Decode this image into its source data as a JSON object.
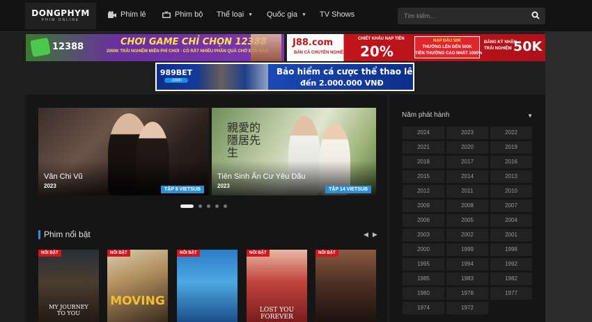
{
  "logo": {
    "main": "DONGPHYM",
    "sub": "PHIM ONLINE"
  },
  "nav": [
    {
      "label": "Phim lẻ",
      "icon": "film-icon"
    },
    {
      "label": "Phim bộ",
      "icon": "tv-icon"
    },
    {
      "label": "Thể loại",
      "icon": "chevron-down-icon"
    },
    {
      "label": "Quốc gia",
      "icon": "chevron-down-icon"
    },
    {
      "label": "TV Shows"
    }
  ],
  "search": {
    "placeholder": "Tìm kiếm..."
  },
  "ads": {
    "a": {
      "brand": "12388",
      "title": "CHƠI GAME CHỈ CHỌN 12388",
      "sub": "2000K TRẢI NGHIỆM MIỄN PHÍ CHƠI · CÓ RẤT NHIỀU PHẦN QUÀ CHỜ ĐÓN BẠN"
    },
    "b": {
      "brand": "J88.com",
      "brand_sub": "BẢN CÁ CHUYÊN NGHIỆP",
      "t1": "CHIẾT KHẤU NẠP TIỀN",
      "pct": "20%",
      "box1": "NẠP ĐẦU 50K",
      "box2": "THƯỞNG LÊN ĐẾN 500K",
      "box3": "TIỀN THƯỞNG CAO NHẤT 1000%",
      "t3a": "ĐĂNG KÝ NHẬN",
      "t3b": "TRẢI NGHIỆM",
      "amount": "50K"
    },
    "c": {
      "brand": "989BET",
      "brand_sub": ".com",
      "t1": "Bảo hiểm cá cược thể thao lên",
      "t2": "đến 2.000.000 VNĐ"
    }
  },
  "slides": [
    {
      "title": "Vân Chi Vũ",
      "year": "2023",
      "badge": "TẬP 8 VIETSUB"
    },
    {
      "title": "Tiên Sinh Ẩn Cư Yêu Dấu",
      "year": "2023",
      "badge": "TẬP 14 VIETSUB",
      "calligraphy": "親愛的隱居先生"
    }
  ],
  "section": {
    "title": "Phim nổi bật",
    "prev": "◀",
    "next": "▶"
  },
  "posters": [
    {
      "tag": "NỔI BẬT",
      "text": "MY JOURNEY TO YOU"
    },
    {
      "tag": "NỔI BẬT",
      "text": "MOVING"
    },
    {
      "tag": "NỔI BẬT",
      "text": ""
    },
    {
      "tag": "NỔI BẬT",
      "text": "LOST YOU FOREVER"
    },
    {
      "tag": "NỔI BẬT",
      "text": ""
    }
  ],
  "sidebar": {
    "title": "Năm phát hành",
    "years": [
      "2024",
      "2023",
      "2022",
      "2021",
      "2020",
      "2019",
      "2018",
      "2017",
      "2016",
      "2015",
      "2014",
      "2013",
      "2012",
      "2011",
      "2010",
      "2009",
      "2008",
      "2007",
      "2006",
      "2005",
      "2004",
      "2003",
      "2002",
      "2001",
      "2000",
      "1999",
      "1998",
      "1995",
      "1994",
      "1992",
      "1985",
      "1983",
      "1982",
      "1980",
      "1978",
      "1977",
      "1974",
      "1972"
    ]
  },
  "colors": {
    "accent": "#2d8fd6",
    "hot": "#d3151e",
    "bg": "#1e1e1e",
    "panel": "#151515"
  }
}
